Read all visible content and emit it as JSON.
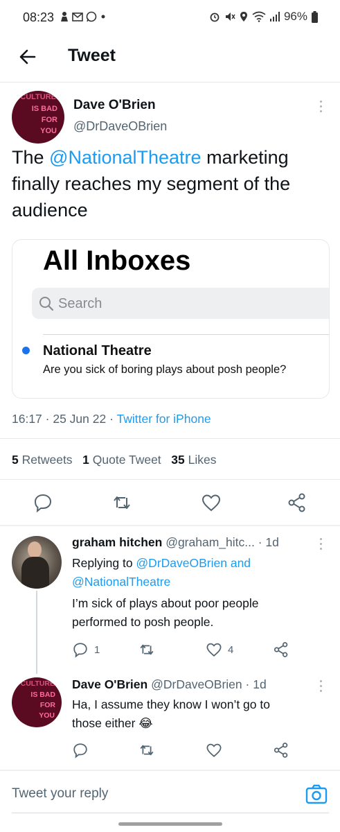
{
  "status_bar": {
    "time": "08:23",
    "battery": "96%",
    "left_icons": [
      "person-icon",
      "gmail-icon",
      "whatsapp-icon",
      "dot-icon"
    ],
    "right_icons": [
      "alarm-icon",
      "mute-icon",
      "location-icon",
      "wifi-icon",
      "signal-icon",
      "battery-icon"
    ]
  },
  "header": {
    "title": "Tweet",
    "back_icon": "back-arrow-icon"
  },
  "main_tweet": {
    "author_name": "Dave O'Brien",
    "author_handle": "@DrDaveOBrien",
    "avatar_text": [
      "CULTURE",
      "IS BAD",
      "FOR",
      "YOU"
    ],
    "text_prefix": "The ",
    "mention": "@NationalTheatre",
    "text_suffix": " marketing finally reaches my segment of the audience",
    "card": {
      "title": "All Inboxes",
      "search_placeholder": "Search",
      "sender": "National Theatre",
      "preview": "Are you sick of boring plays about posh people?"
    },
    "time": "16:17",
    "date": "25 Jun 22",
    "source": "Twitter for iPhone",
    "stats": {
      "retweets_count": "5",
      "retweets_label": "Retweets",
      "quotes_count": "1",
      "quotes_label": "Quote Tweet",
      "likes_count": "35",
      "likes_label": "Likes"
    }
  },
  "replies": [
    {
      "author_name": "graham hitchen",
      "author_handle": "@graham_hitc...",
      "age": "· 1d",
      "replying_prefix": "Replying to ",
      "replying_to_1": "@DrDaveOBrien",
      "replying_and": " and",
      "replying_to_2": "@NationalTheatre",
      "text": "I’m sick of plays about poor people performed to posh people.",
      "reply_count": "1",
      "like_count": "4"
    },
    {
      "author_name": "Dave O'Brien",
      "author_handle": "@DrDaveOBrien",
      "age": "· 1d",
      "text": "Ha, I assume they know I won’t go to those either 😂"
    }
  ],
  "composer": {
    "placeholder": "Tweet your reply",
    "camera_icon": "camera-icon"
  },
  "colors": {
    "link": "#1d9bf0",
    "secondary_text": "#536471",
    "divider": "#e6e9eb"
  }
}
